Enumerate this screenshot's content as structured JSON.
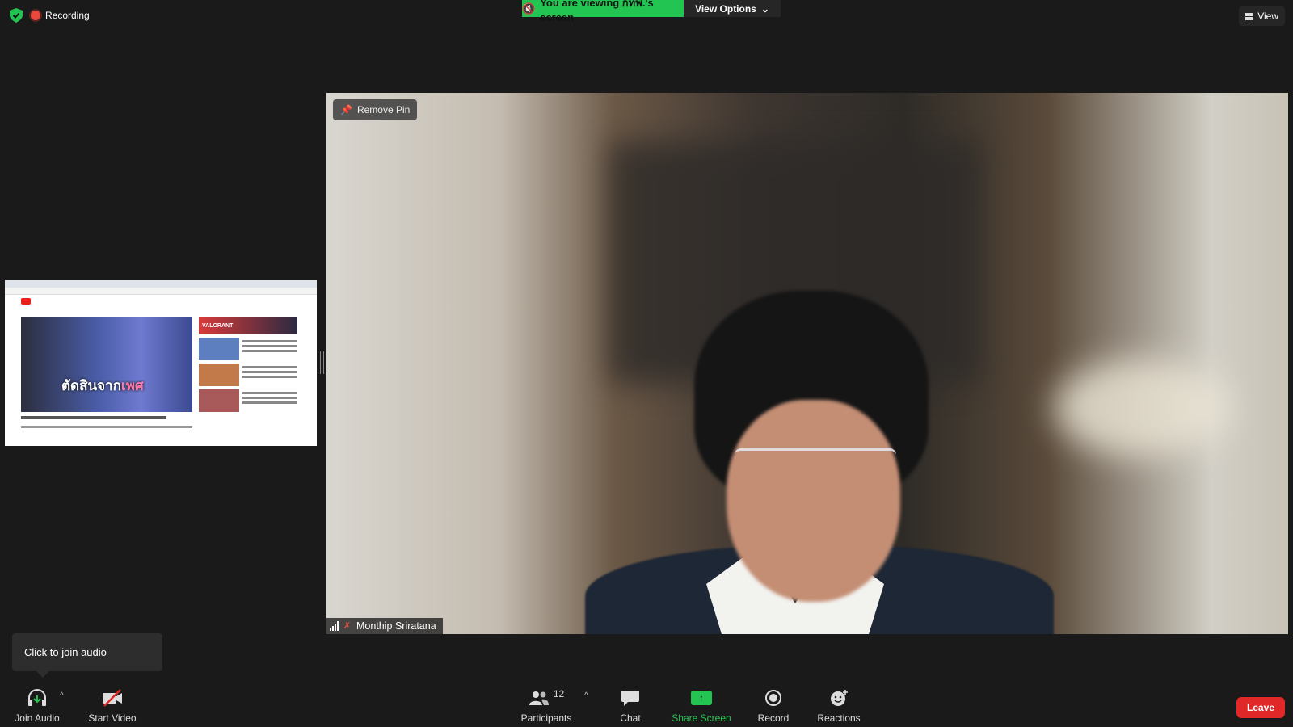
{
  "top": {
    "recording_label": "Recording",
    "viewing_banner": "You are viewing กทพ.'s screen",
    "view_options_label": "View Options",
    "view_label": "View"
  },
  "main_video": {
    "remove_pin_label": "Remove Pin",
    "participant_name": "Monthip Sriratana"
  },
  "tooltip": {
    "text": "Click to join audio"
  },
  "toolbar": {
    "join_audio": "Join Audio",
    "start_video": "Start Video",
    "participants": "Participants",
    "participants_count": "12",
    "chat": "Chat",
    "share_screen": "Share Screen",
    "record": "Record",
    "reactions": "Reactions",
    "leave": "Leave"
  },
  "shared_screen": {
    "caption_part1": "ตัดสินจาก",
    "caption_part2": "เพศ",
    "ad_label": "VALORANT"
  },
  "colors": {
    "share_green": "#23c552",
    "leave_red": "#e02828",
    "recording_red": "#e8493d"
  }
}
